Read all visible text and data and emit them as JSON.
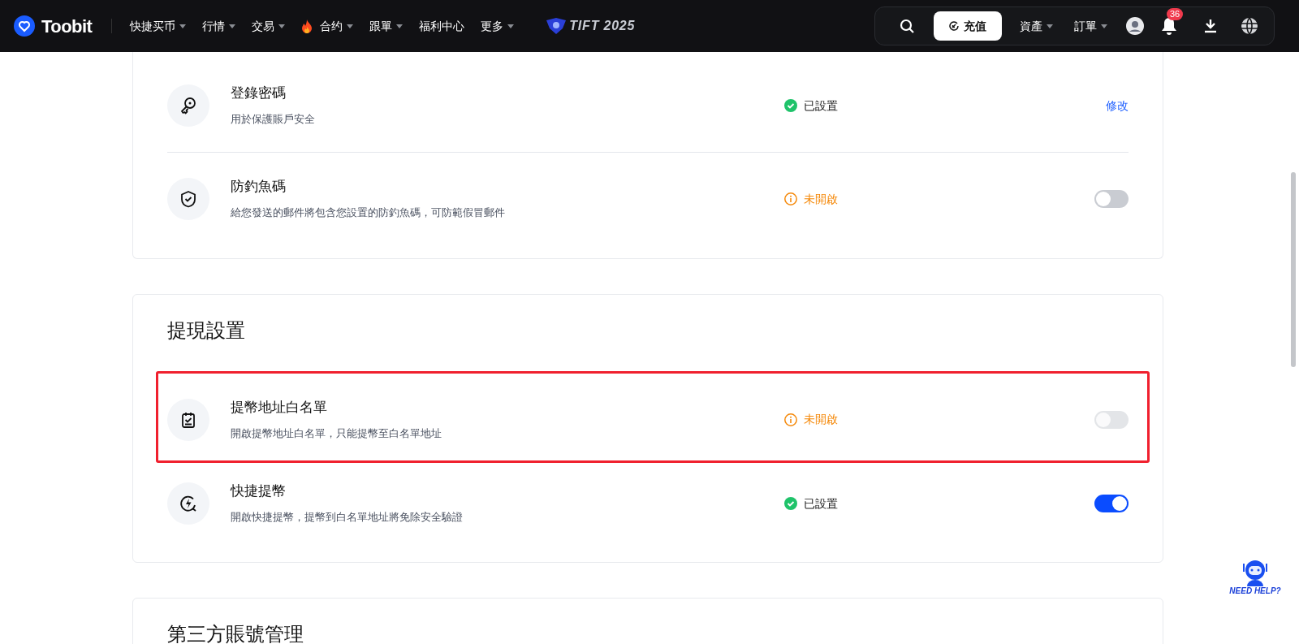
{
  "nav": {
    "logo_text": "Toobit",
    "menu": [
      {
        "label": "快捷买币",
        "dropdown": true
      },
      {
        "label": "行情",
        "dropdown": true
      },
      {
        "label": "交易",
        "dropdown": true
      },
      {
        "label": "合约",
        "dropdown": true
      },
      {
        "label": "跟單",
        "dropdown": true
      },
      {
        "label": "福利中心",
        "dropdown": false
      },
      {
        "label": "更多",
        "dropdown": true
      }
    ],
    "event_logo_text": "TIFT 2025",
    "deposit_button": "充值",
    "account_menu": [
      {
        "label": "資產",
        "dropdown": true
      },
      {
        "label": "訂單",
        "dropdown": true
      }
    ],
    "notification_count": "36"
  },
  "sections": [
    {
      "rows": [
        {
          "title": "登錄密碼",
          "description": "用於保護賬戶安全",
          "status": {
            "kind": "set",
            "text": "已設置"
          },
          "control": {
            "kind": "link",
            "label": "修改"
          },
          "highlighted": false
        },
        {
          "title": "防釣魚碼",
          "description": "給您發送的郵件將包含您設置的防釣魚碼，可防範假冒郵件",
          "status": {
            "kind": "unset",
            "text": "未開啟"
          },
          "control": {
            "kind": "toggle",
            "on": false,
            "disabled": false
          },
          "highlighted": false
        }
      ]
    },
    {
      "title": "提現設置",
      "rows": [
        {
          "title": "提幣地址白名單",
          "description": "開啟提幣地址白名單，只能提幣至白名單地址",
          "status": {
            "kind": "unset",
            "text": "未開啟"
          },
          "control": {
            "kind": "toggle",
            "on": false,
            "disabled": true
          },
          "highlighted": true
        },
        {
          "title": "快捷提幣",
          "description": "開啟快捷提幣，提幣到白名單地址將免除安全驗證",
          "status": {
            "kind": "set",
            "text": "已設置"
          },
          "control": {
            "kind": "toggle",
            "on": true,
            "disabled": false
          },
          "highlighted": false
        }
      ]
    },
    {
      "title": "第三方賬號管理"
    }
  ],
  "help_widget": {
    "label": "NEED HELP?"
  }
}
